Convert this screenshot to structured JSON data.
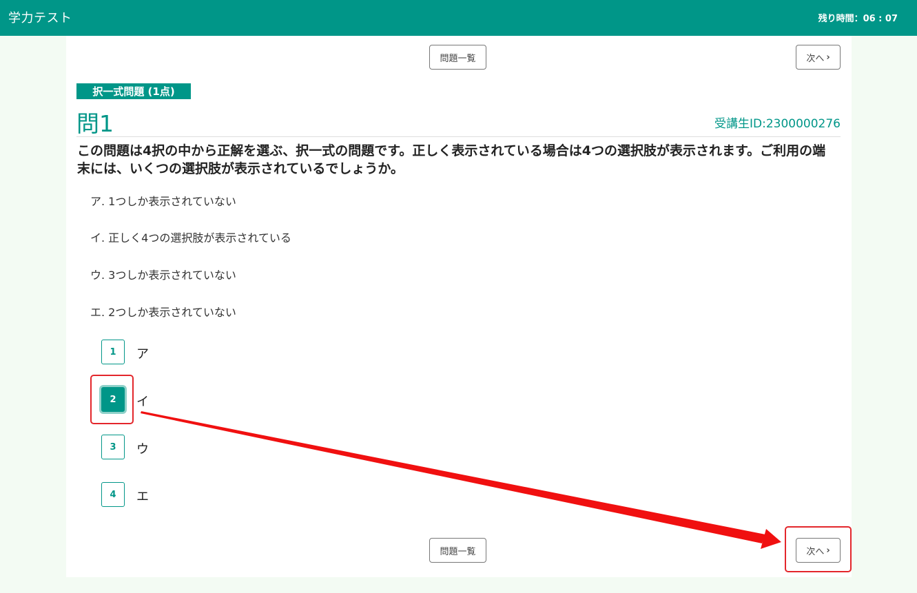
{
  "header": {
    "title": "学力テスト",
    "timer": "残り時間：06 : 07"
  },
  "nav": {
    "list_label": "問題一覧",
    "next_label": "次へ",
    "next_icon": "chevron-right-icon"
  },
  "question": {
    "type_badge": "択一式問題 (1点)",
    "number": "問1",
    "student_id": "受講生ID:2300000276",
    "text": "この問題は4択の中から正解を選ぶ、択一式の問題です。正しく表示されている場合は4つの選択肢が表示されます。ご利用の端末には、いくつの選択肢が表示されているでしょうか。",
    "choices": [
      "ア. 1つしか表示されていない",
      "イ. 正しく4つの選択肢が表示されている",
      "ウ. 3つしか表示されていない",
      "エ. 2つしか表示されていない"
    ]
  },
  "answers": [
    {
      "num": "1",
      "label": "ア",
      "selected": false
    },
    {
      "num": "2",
      "label": "イ",
      "selected": true
    },
    {
      "num": "3",
      "label": "ウ",
      "selected": false
    },
    {
      "num": "4",
      "label": "エ",
      "selected": false
    }
  ],
  "colors": {
    "accent": "#009688",
    "annotation": "#e3262b",
    "background": "#f3fbf3"
  }
}
